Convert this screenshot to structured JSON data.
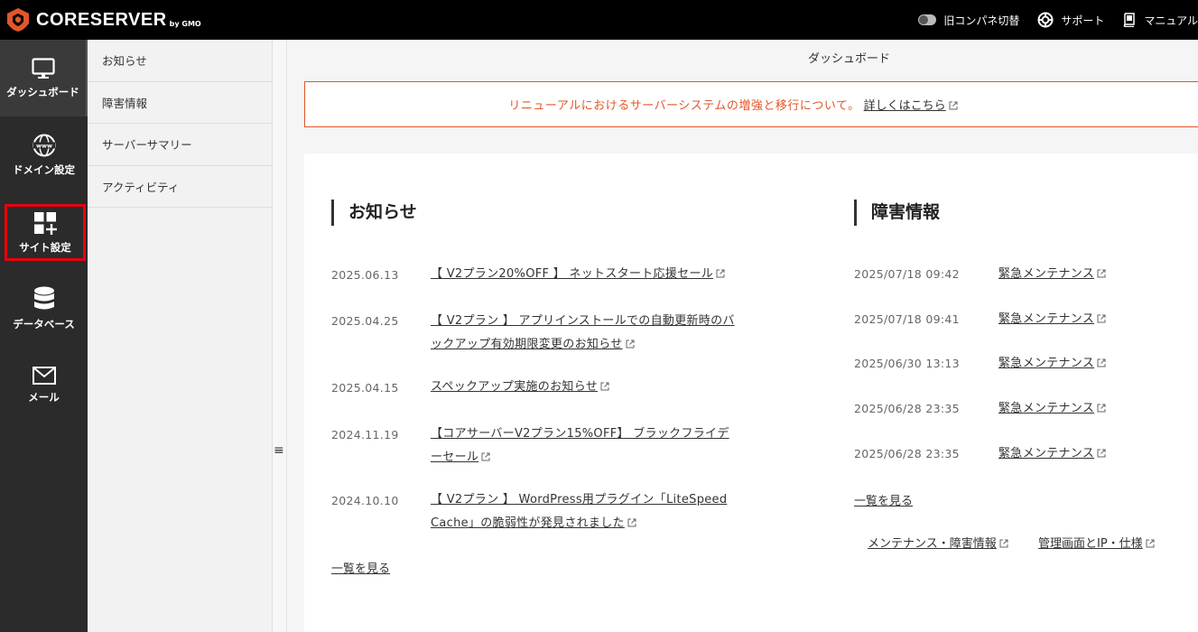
{
  "app": {
    "logo_text": "CORESERVER",
    "logo_sub": "by GMO"
  },
  "topnav": {
    "legacy_toggle": "旧コンパネ切替",
    "support": "サポート",
    "manual": "マニュアル"
  },
  "sidenav": {
    "items": [
      {
        "label": "ダッシュボード",
        "icon": "monitor-icon"
      },
      {
        "label": "ドメイン設定",
        "icon": "www-globe-icon"
      },
      {
        "label": "サイト設定",
        "icon": "grid-plus-icon"
      },
      {
        "label": "データベース",
        "icon": "database-icon"
      },
      {
        "label": "メール",
        "icon": "envelope-icon"
      }
    ]
  },
  "subnav": {
    "items": [
      "お知らせ",
      "障害情報",
      "サーバーサマリー",
      "アクティビティ"
    ]
  },
  "page": {
    "title": "ダッシュボード",
    "notice_text": "リニューアルにおけるサーバーシステムの増強と移行について。",
    "notice_link": "詳しくはこちら"
  },
  "news": {
    "heading": "お知らせ",
    "items": [
      {
        "date": "2025.06.13",
        "title1": "【 V2プラン20%OFF 】 ネットスタート応援セール",
        "title2": ""
      },
      {
        "date": "2025.04.25",
        "title1": "【 V2プラン 】 アプリインストールでの自動更新時のバ",
        "title2": "ックアップ有効期限変更のお知らせ"
      },
      {
        "date": "2025.04.15",
        "title1": "スペックアップ実施のお知らせ",
        "title2": ""
      },
      {
        "date": "2024.11.19",
        "title1": "【コアサーバーV2プラン15%OFF】 ブラックフライデ",
        "title2": "ーセール"
      },
      {
        "date": "2024.10.10",
        "title1": "【 V2プラン 】 WordPress用プラグイン「LiteSpeed",
        "title2": "Cache」の脆弱性が発見されました"
      }
    ],
    "more": "一覧を見る"
  },
  "incidents": {
    "heading": "障害情報",
    "items": [
      {
        "date": "2025/07/18 09:42",
        "title": "緊急メンテナンス"
      },
      {
        "date": "2025/07/18 09:41",
        "title": "緊急メンテナンス"
      },
      {
        "date": "2025/06/30 13:13",
        "title": "緊急メンテナンス"
      },
      {
        "date": "2025/06/28 23:35",
        "title": "緊急メンテナンス"
      },
      {
        "date": "2025/06/28 23:35",
        "title": "緊急メンテナンス"
      }
    ],
    "more": "一覧を見る",
    "footer_link1": "メンテナンス・障害情報",
    "footer_link2": "管理画面とIP・仕様"
  },
  "colors": {
    "topbar": "#000000",
    "sidebar": "#2b2b2b",
    "accent_orange": "#e2572a",
    "highlight_red": "#e8000b"
  }
}
